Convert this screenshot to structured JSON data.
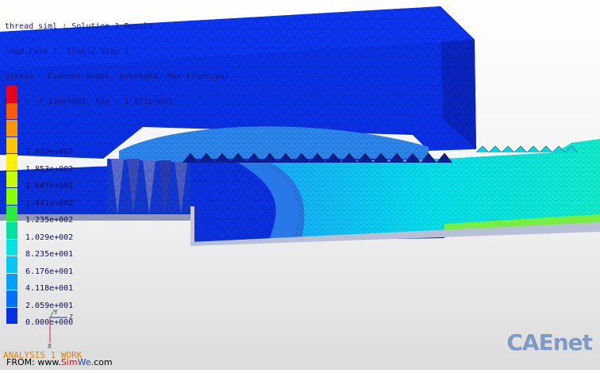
{
  "header": {
    "line1": "thread_siml : Solution 1 Result",
    "line2": "Load Case 1, Static Step 1",
    "line3": "Stress - Element-Nodal, Averaged, Max Principal",
    "line4": "Min : -7.136e+001, Max : 5.071e+003"
  },
  "legend": {
    "labels": [
      "2.059e+002",
      "1.853e+002",
      "1.647e+002",
      "1.441e+002",
      "1.235e+002",
      "1.029e+002",
      "8.235e+001",
      "6.176e+001",
      "4.118e+001",
      "2.059e+001",
      "0.000e+000"
    ],
    "colors": [
      "#e8001c",
      "#ff5a00",
      "#ff9800",
      "#ffc600",
      "#ffef00",
      "#c8ff00",
      "#8aff00",
      "#2aee3c",
      "#00e0a0",
      "#00e4e4",
      "#00c8ff",
      "#00a0ff",
      "#0070ff",
      "#0030e0"
    ]
  },
  "triad": {
    "x": "X",
    "y": "Y",
    "z": "Z"
  },
  "footer": {
    "analysis": "ANALYSIS 1 WORK",
    "from_prefix": "FROM: www.",
    "from_sim": "Sim",
    "from_we": "We",
    "from_suffix": ".com"
  },
  "watermark": "CAEnet",
  "colors": {
    "background": "#f0f0f0",
    "part": "#0a2ee0",
    "text": "#1a1a7a"
  }
}
